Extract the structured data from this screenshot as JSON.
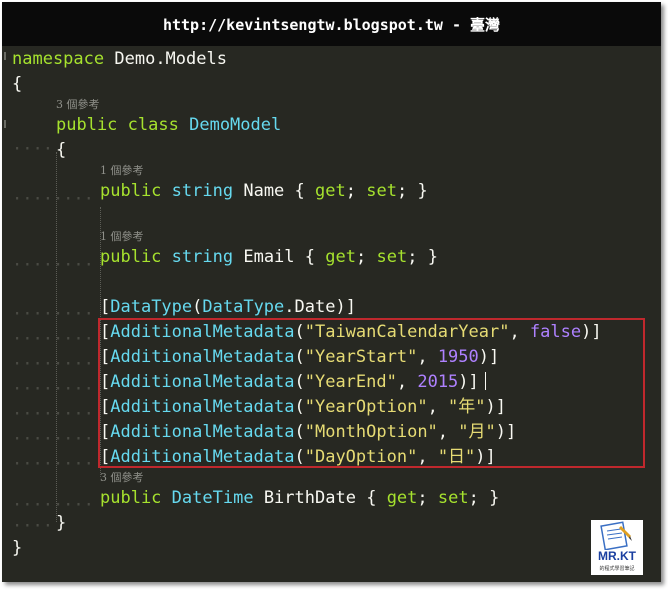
{
  "banner": {
    "url_text": "http://kevintsengtw.blogspot.tw - 臺灣"
  },
  "code": {
    "l1_kw": "namespace",
    "l1_name": "Demo.Models",
    "l2": "{",
    "ref_class": "3 個參考",
    "l4_public": "public",
    "l4_class": "class",
    "l4_type": "DemoModel",
    "l5": "{",
    "ref_name": "1 個參考",
    "l7_public": "public",
    "l7_type": "string",
    "l7_name": "Name",
    "l7_open": "{",
    "l7_get": "get",
    "l7_set": "set",
    "l7_close": "}",
    "ref_email": "1 個參考",
    "l9_public": "public",
    "l9_type": "string",
    "l9_name": "Email",
    "l9_open": "{",
    "l9_get": "get",
    "l9_set": "set",
    "l9_close": "}",
    "attr_datatype": "DataType",
    "attr_datatype_enum": "DataType",
    "attr_datatype_member": "Date",
    "attr_meta": "AdditionalMetadata",
    "meta": [
      {
        "key": "\"TaiwanCalendarYear\"",
        "value": "false"
      },
      {
        "key": "\"YearStart\"",
        "value": "1950"
      },
      {
        "key": "\"YearEnd\"",
        "value": "2015"
      },
      {
        "key": "\"YearOption\"",
        "value": "\"年\""
      },
      {
        "key": "\"MonthOption\"",
        "value": "\"月\""
      },
      {
        "key": "\"DayOption\"",
        "value": "\"日\""
      }
    ],
    "ref_birth": "3 個參考",
    "l18_public": "public",
    "l18_type": "DateTime",
    "l18_name": "BirthDate",
    "l18_open": "{",
    "l18_get": "get",
    "l18_set": "set",
    "l18_close": "}",
    "l19": "}",
    "l20": "}"
  },
  "logo": {
    "text": "MR.KT",
    "subtitle": "的程式學習筆記"
  },
  "colors": {
    "background": "#272822",
    "keyword": "#a6e22e",
    "type": "#66d9ef",
    "string": "#e6db74",
    "number": "#ae81ff",
    "highlight": "#c0282d"
  }
}
